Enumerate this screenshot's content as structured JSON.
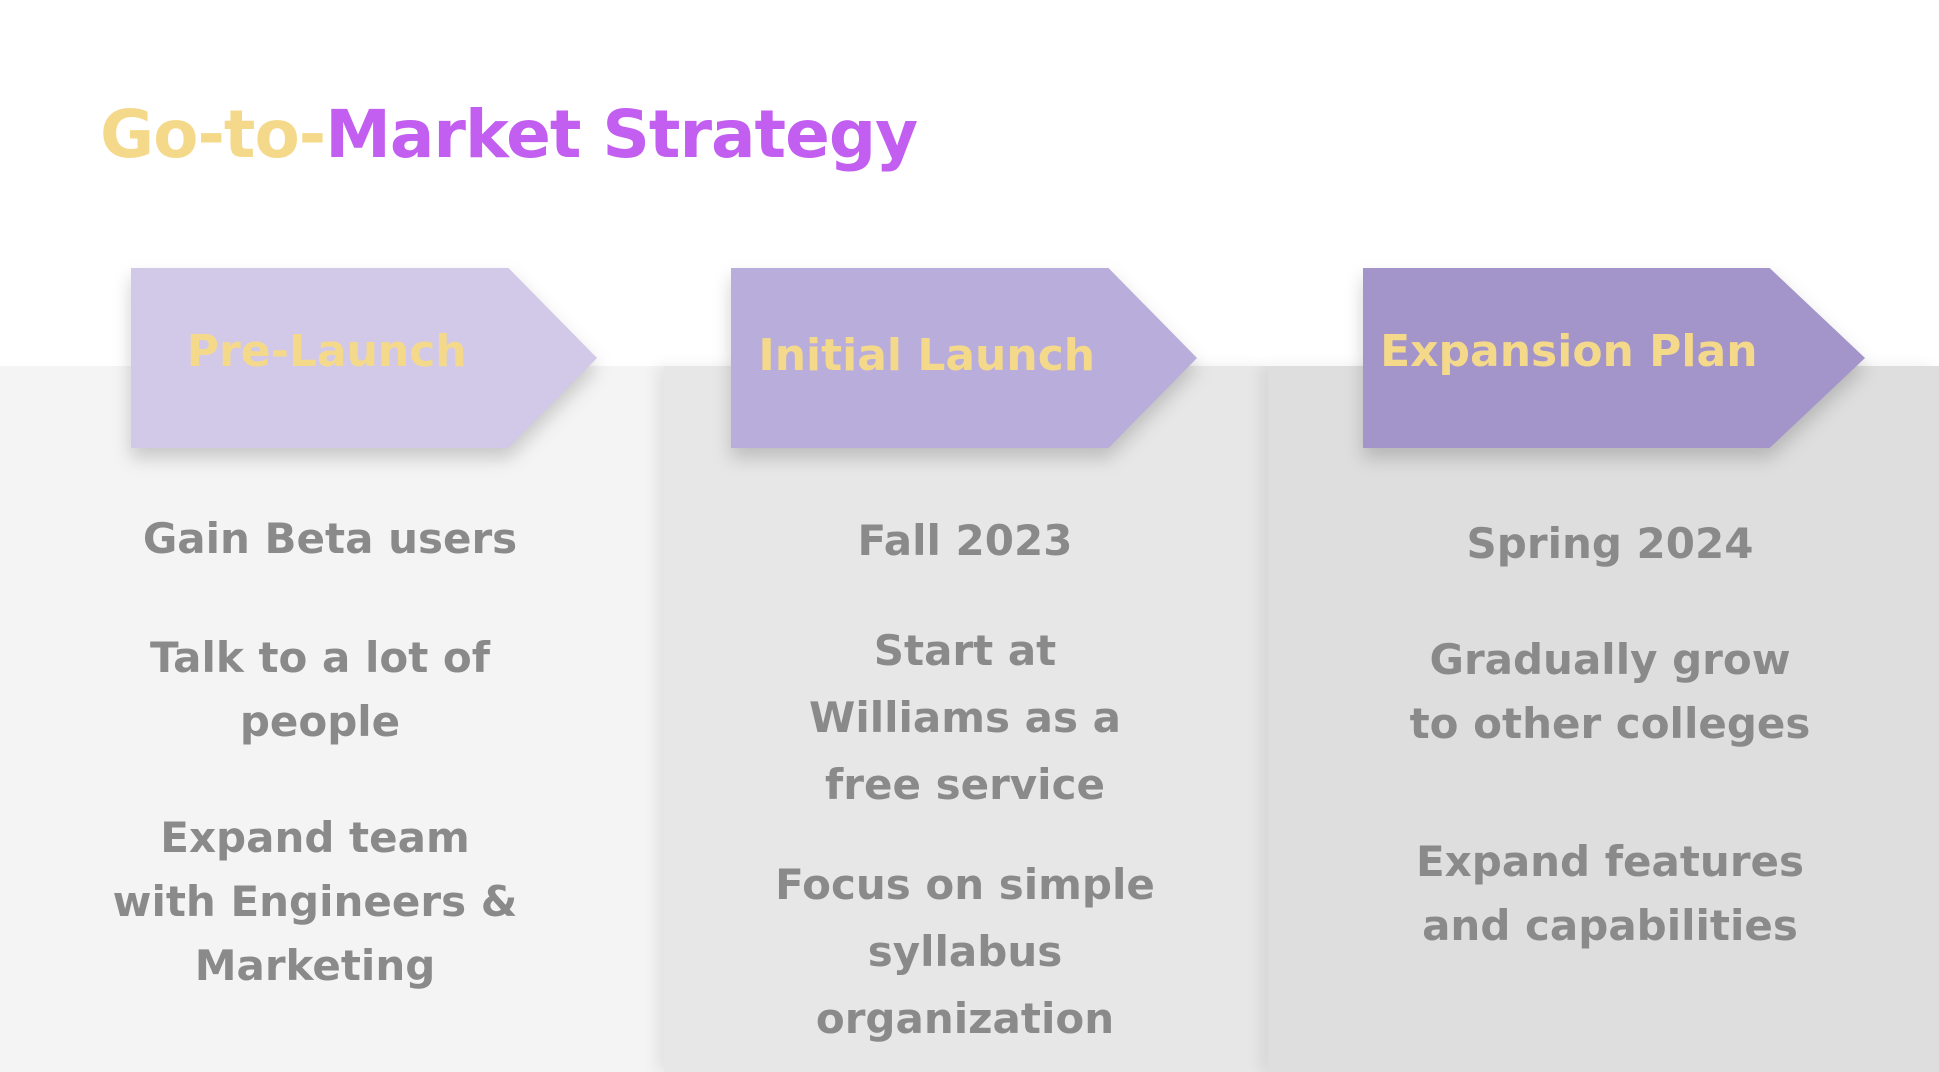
{
  "title": {
    "part1": "Go-to-",
    "part2": "Market Strategy"
  },
  "colors": {
    "title_yellow": "#f5d98b",
    "title_purple": "#c25ef0",
    "arrow_1": "#d2c9e8",
    "arrow_2": "#b9addb",
    "arrow_3": "#a394ca",
    "body_text": "#8a8a8a"
  },
  "phases": [
    {
      "heading": "Pre-Launch",
      "items": [
        "Gain Beta users",
        "Talk to a lot of\npeople",
        "Expand team\nwith Engineers &\nMarketing"
      ]
    },
    {
      "heading": "Initial Launch",
      "items": [
        "Fall 2023",
        "Start at\nWilliams as a\nfree service",
        "Focus on simple\nsyllabus\norganization"
      ]
    },
    {
      "heading": "Expansion Plan",
      "items": [
        "Spring 2024",
        "Gradually grow\nto other colleges",
        "Expand features\nand capabilities"
      ]
    }
  ]
}
